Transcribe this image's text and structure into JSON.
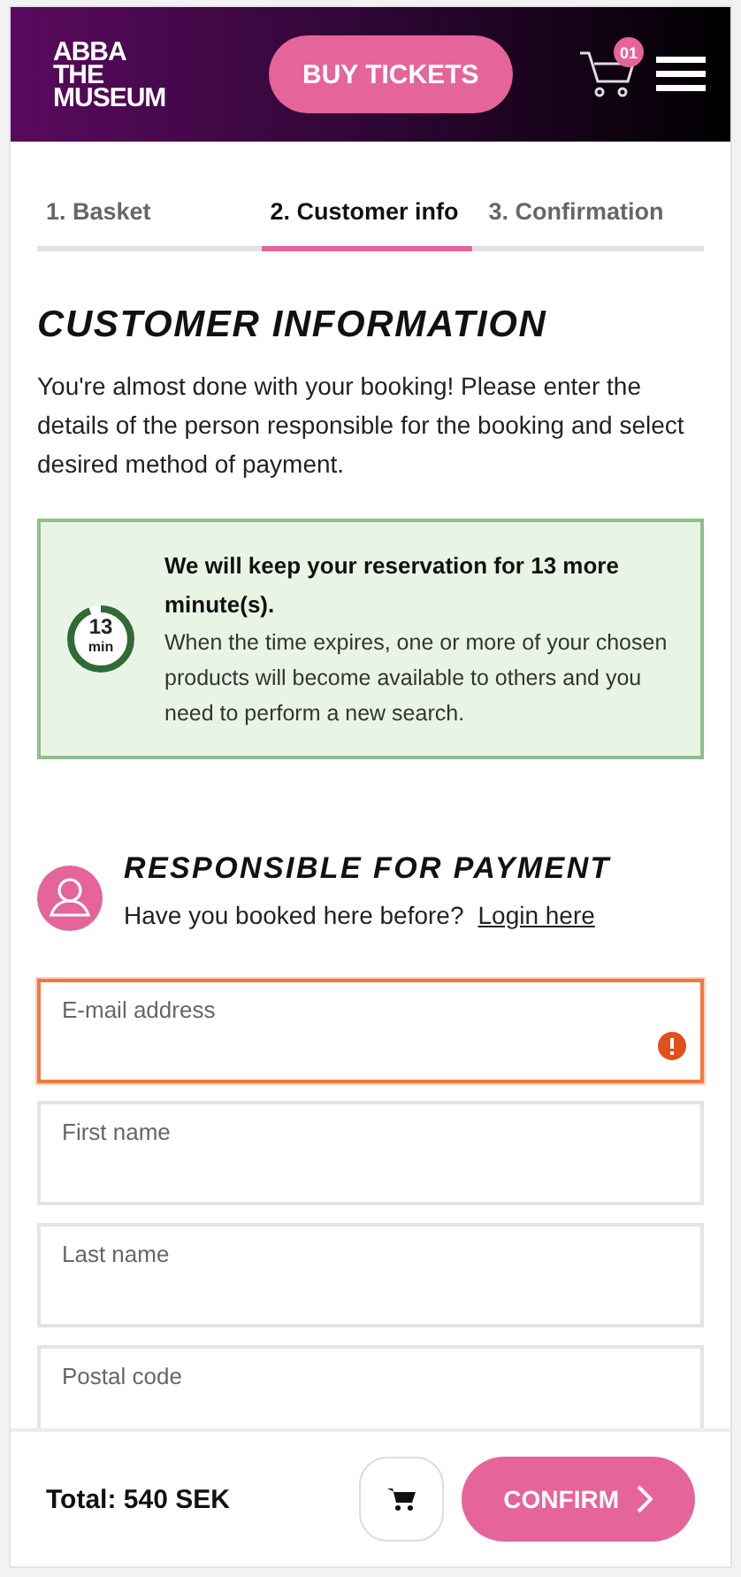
{
  "header": {
    "logo": [
      "ABBA",
      "THE",
      "MUSEUM"
    ],
    "buy_button": "BUY TICKETS",
    "cart_count": "01"
  },
  "steps": [
    {
      "label": "1. Basket",
      "selected": false
    },
    {
      "label": "2. Customer info",
      "selected": true
    },
    {
      "label": "3. Confirmation",
      "selected": false
    }
  ],
  "title": "CUSTOMER INFORMATION",
  "intro": "You're almost done with your booking! Please enter the details of the person responsible for the booking and select desired method of payment.",
  "notice": {
    "timer_value": "13",
    "timer_unit": "min",
    "level": 0.94,
    "heading": "We will keep your reservation for 13 more minute(s).",
    "text": "When the time expires, one or more of your chosen products will become available to others and you need to perform a new search."
  },
  "section": {
    "title": "RESPONSIBLE FOR PAYMENT",
    "question": "Have you booked here before?",
    "link": "Login here"
  },
  "fields": [
    {
      "label": "E-mail address",
      "error": true
    },
    {
      "label": "First name",
      "error": false
    },
    {
      "label": "Last name",
      "error": false
    },
    {
      "label": "Postal code",
      "error": false
    }
  ],
  "footer": {
    "total": "Total: 540 SEK",
    "confirm": "CONFIRM"
  }
}
